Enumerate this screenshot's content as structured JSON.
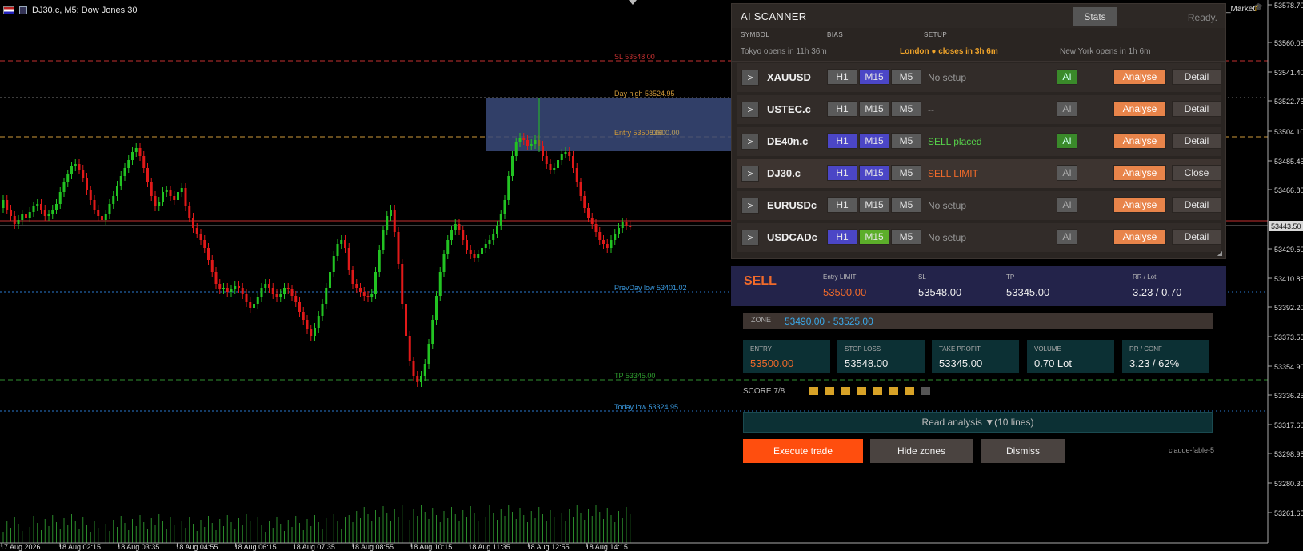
{
  "chart": {
    "title": "DJ30.c, M5:  Dow Jones 30",
    "market_label": "_Market",
    "price_axis": [
      "53578.70",
      "53560.05",
      "53541.40",
      "53522.75",
      "53504.10",
      "53485.45",
      "53466.80",
      "53429.50",
      "53410.85",
      "53392.20",
      "53373.55",
      "53354.90",
      "53336.25",
      "53317.60",
      "53298.95",
      "53280.30",
      "53261.65"
    ],
    "current_price": "53443.50",
    "time_axis": [
      "17 Aug 2026",
      "18 Aug 02:15",
      "18 Aug 03:35",
      "18 Aug 04:55",
      "18 Aug 06:15",
      "18 Aug 07:35",
      "18 Aug 08:55",
      "18 Aug 10:15",
      "18 Aug 11:35",
      "18 Aug 12:55",
      "18 Aug 14:15"
    ],
    "levels": {
      "sl": "SL 53548.00",
      "day_high": "Day high 53524.95",
      "entry": "Entry 53500.00",
      "entry_overlap": "53500.00",
      "prevday_low": "PrevDay low 53401.02",
      "tp": "TP 53345.00",
      "today_low": "Today low 53324.95"
    },
    "colors": {
      "bull": "#22c322",
      "bear": "#e01919",
      "sl": "#c43030",
      "tp": "#2f8f2f",
      "info": "#2a7ad0",
      "dayhigh": "#d09a3a"
    }
  },
  "scanner": {
    "title": "AI SCANNER",
    "stats_label": "Stats",
    "status": "Ready.",
    "col_symbol": "SYMBOL",
    "col_bias": "BIAS",
    "col_setup": "SETUP",
    "session_tokyo": "Tokyo  opens in 11h 36m",
    "session_london": "London ● closes in 3h 6m",
    "session_newyork": "New York  opens in 1h 6m",
    "expand_label": ">",
    "h1": "H1",
    "m15": "M15",
    "m5": "M5",
    "ai_label": "AI",
    "analyse_label": "Analyse",
    "rows": [
      {
        "symbol": "XAUUSD",
        "setup": "No setup",
        "detail": "Detail"
      },
      {
        "symbol": "USTEC.c",
        "setup": "--",
        "detail": "Detail"
      },
      {
        "symbol": "DE40n.c",
        "setup": "SELL placed",
        "detail": "Detail"
      },
      {
        "symbol": "DJ30.c",
        "setup": "SELL LIMIT",
        "detail": "Close"
      },
      {
        "symbol": "EURUSDc",
        "setup": "No setup",
        "detail": "Detail"
      },
      {
        "symbol": "USDCADc",
        "setup": "No setup",
        "detail": "Detail"
      }
    ]
  },
  "signal": {
    "side": "SELL",
    "entry_label": "Entry LIMIT",
    "entry_value": "53500.00",
    "sl_label": "SL",
    "sl_value": "53548.00",
    "tp_label": "TP",
    "tp_value": "53345.00",
    "rr_label": "RR / Lot",
    "rr_value": "3.23 / 0.70"
  },
  "zone": {
    "label": "ZONE",
    "value": "53490.00 - 53525.00"
  },
  "cards": [
    {
      "label": "ENTRY",
      "value": "53500.00"
    },
    {
      "label": "STOP LOSS",
      "value": "53548.00"
    },
    {
      "label": "TAKE PROFIT",
      "value": "53345.00"
    },
    {
      "label": "VOLUME",
      "value": "0.70 Lot"
    },
    {
      "label": "RR / CONF",
      "value": "3.23 / 62%"
    }
  ],
  "score": {
    "label": "SCORE 7/8",
    "value": 7,
    "max": 8
  },
  "read_analysis": "Read analysis ▼(10 lines)",
  "actions": {
    "execute": "Execute trade",
    "hide": "Hide zones",
    "dismiss": "Dismiss"
  },
  "model_label": "claude-fable-5"
}
